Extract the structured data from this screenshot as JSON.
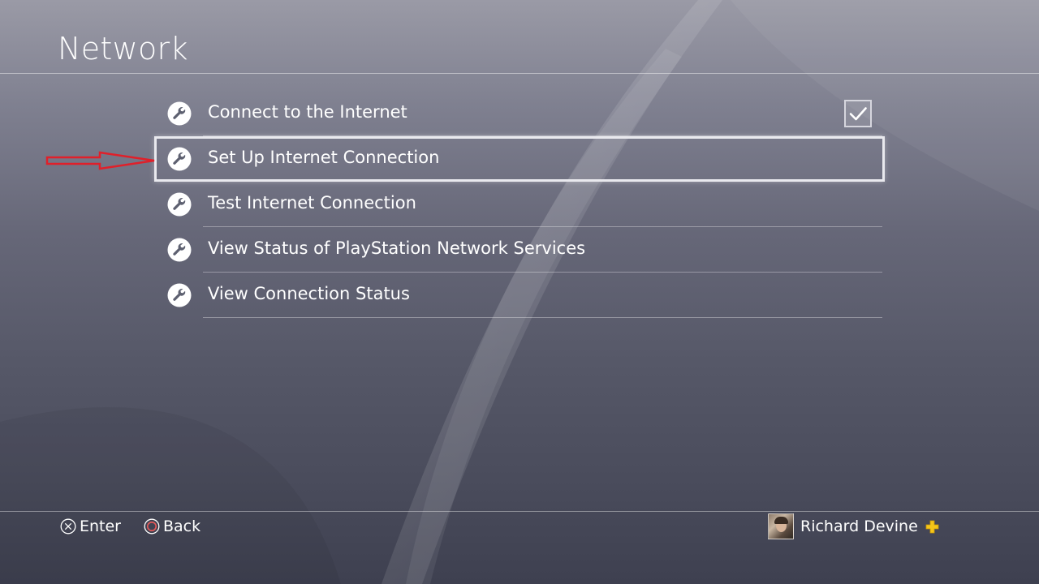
{
  "page": {
    "title": "Network"
  },
  "menu": {
    "items": [
      {
        "label": "Connect to the Internet",
        "icon": "wrench-icon",
        "checked": true
      },
      {
        "label": "Set Up Internet Connection",
        "icon": "wrench-icon",
        "selected": true
      },
      {
        "label": "Test Internet Connection",
        "icon": "wrench-icon"
      },
      {
        "label": "View Status of PlayStation Network Services",
        "icon": "wrench-icon"
      },
      {
        "label": "View Connection Status",
        "icon": "wrench-icon"
      }
    ]
  },
  "footer": {
    "enter_label": "Enter",
    "enter_icon": "cross-button-icon",
    "back_label": "Back",
    "back_icon": "circle-button-icon",
    "user_name": "Richard Devine",
    "plus_icon": "playstation-plus-icon"
  },
  "colors": {
    "annotation_arrow": "#e0202a",
    "circle_button": "#e85a5a",
    "plus_badge": "#f5c518",
    "selection_border": "#e9e9ee"
  }
}
